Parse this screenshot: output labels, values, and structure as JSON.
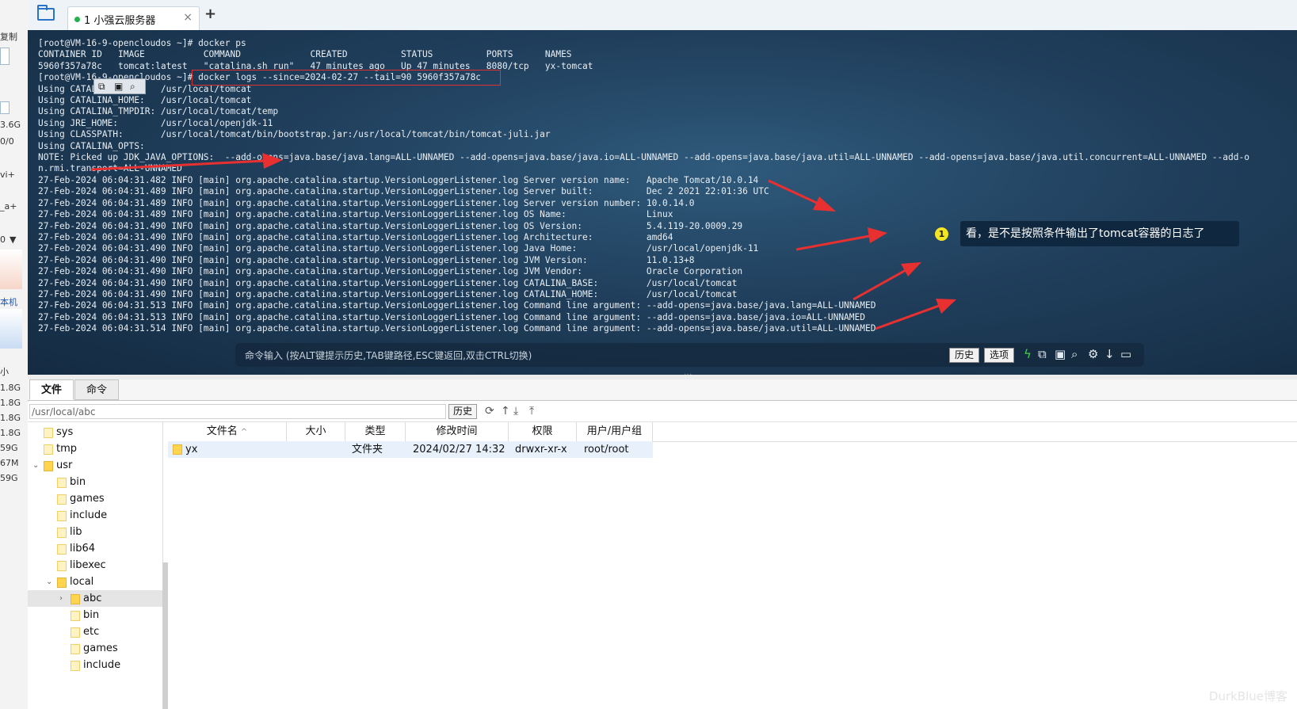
{
  "left_strip": {
    "labels": [
      "复制",
      "3.6G",
      "0/0",
      "vi+",
      "_a+",
      "0",
      "本机",
      "小",
      "1.8G",
      "1.8G",
      "1.8G",
      "1.8G",
      "59G",
      "67M",
      "59G"
    ]
  },
  "tabbar": {
    "session_tab_title": "1 小强云服务器",
    "close_glyph": "×",
    "add_glyph": "+"
  },
  "terminal": {
    "lines": [
      "[root@VM-16-9-opencloudos ~]# docker ps",
      "CONTAINER ID   IMAGE           COMMAND             CREATED          STATUS          PORTS      NAMES",
      "5960f357a78c   tomcat:latest   \"catalina.sh run\"   47 minutes ago   Up 47 minutes   8080/tcp   yx-tomcat",
      "[root@VM-16-9-opencloudos ~]# docker logs --since=2024-02-27 --tail=90 5960f357a78c",
      "Using CATALINA_BASE:   /usr/local/tomcat",
      "Using CATALINA_HOME:   /usr/local/tomcat",
      "Using CATALINA_TMPDIR: /usr/local/tomcat/temp",
      "Using JRE_HOME:        /usr/local/openjdk-11",
      "Using CLASSPATH:       /usr/local/tomcat/bin/bootstrap.jar:/usr/local/tomcat/bin/tomcat-juli.jar",
      "Using CATALINA_OPTS:",
      "NOTE: Picked up JDK_JAVA_OPTIONS:  --add-opens=java.base/java.lang=ALL-UNNAMED --add-opens=java.base/java.io=ALL-UNNAMED --add-opens=java.base/java.util=ALL-UNNAMED --add-opens=java.base/java.util.concurrent=ALL-UNNAMED --add-o",
      "n.rmi.transport=ALL-UNNAMED",
      "27-Feb-2024 06:04:31.482 INFO [main] org.apache.catalina.startup.VersionLoggerListener.log Server version name:   Apache Tomcat/10.0.14",
      "27-Feb-2024 06:04:31.489 INFO [main] org.apache.catalina.startup.VersionLoggerListener.log Server built:          Dec 2 2021 22:01:36 UTC",
      "27-Feb-2024 06:04:31.489 INFO [main] org.apache.catalina.startup.VersionLoggerListener.log Server version number: 10.0.14.0",
      "27-Feb-2024 06:04:31.489 INFO [main] org.apache.catalina.startup.VersionLoggerListener.log OS Name:               Linux",
      "27-Feb-2024 06:04:31.490 INFO [main] org.apache.catalina.startup.VersionLoggerListener.log OS Version:            5.4.119-20.0009.29",
      "27-Feb-2024 06:04:31.490 INFO [main] org.apache.catalina.startup.VersionLoggerListener.log Architecture:          amd64",
      "27-Feb-2024 06:04:31.490 INFO [main] org.apache.catalina.startup.VersionLoggerListener.log Java Home:             /usr/local/openjdk-11",
      "27-Feb-2024 06:04:31.490 INFO [main] org.apache.catalina.startup.VersionLoggerListener.log JVM Version:           11.0.13+8",
      "27-Feb-2024 06:04:31.490 INFO [main] org.apache.catalina.startup.VersionLoggerListener.log JVM Vendor:            Oracle Corporation",
      "27-Feb-2024 06:04:31.490 INFO [main] org.apache.catalina.startup.VersionLoggerListener.log CATALINA_BASE:         /usr/local/tomcat",
      "27-Feb-2024 06:04:31.490 INFO [main] org.apache.catalina.startup.VersionLoggerListener.log CATALINA_HOME:         /usr/local/tomcat",
      "27-Feb-2024 06:04:31.513 INFO [main] org.apache.catalina.startup.VersionLoggerListener.log Command line argument: --add-opens=java.base/java.lang=ALL-UNNAMED",
      "27-Feb-2024 06:04:31.513 INFO [main] org.apache.catalina.startup.VersionLoggerListener.log Command line argument: --add-opens=java.base/java.io=ALL-UNNAMED",
      "27-Feb-2024 06:04:31.514 INFO [main] org.apache.catalina.startup.VersionLoggerListener.log Command line argument: --add-opens=java.base/java.util=ALL-UNNAMED"
    ],
    "annotation": {
      "number": "1",
      "text": "看，是不是按照条件输出了tomcat容器的日志了"
    },
    "command_bar": {
      "placeholder": "命令输入 (按ALT键提示历史,TAB键路径,ESC键返回,双击CTRL切换)",
      "history_label": "历史",
      "options_label": "选项"
    }
  },
  "colors": {
    "accent_red": "#e83030",
    "annotation_yellow": "#f4e523",
    "status_green": "#23b14d"
  },
  "bottom_tabs": [
    "文件",
    "命令"
  ],
  "path_bar": {
    "path": "/usr/local/abc",
    "history_label": "历史"
  },
  "tree": [
    {
      "name": "sys",
      "level": 0,
      "expanded": false,
      "selected": false
    },
    {
      "name": "tmp",
      "level": 0,
      "expanded": false,
      "selected": false
    },
    {
      "name": "usr",
      "level": 0,
      "expanded": true,
      "selected": false
    },
    {
      "name": "bin",
      "level": 1,
      "expanded": false,
      "selected": false
    },
    {
      "name": "games",
      "level": 1,
      "expanded": false,
      "selected": false
    },
    {
      "name": "include",
      "level": 1,
      "expanded": false,
      "selected": false
    },
    {
      "name": "lib",
      "level": 1,
      "expanded": false,
      "selected": false
    },
    {
      "name": "lib64",
      "level": 1,
      "expanded": false,
      "selected": false
    },
    {
      "name": "libexec",
      "level": 1,
      "expanded": false,
      "selected": false
    },
    {
      "name": "local",
      "level": 1,
      "expanded": true,
      "selected": false
    },
    {
      "name": "abc",
      "level": 2,
      "expanded": false,
      "selected": true
    },
    {
      "name": "bin",
      "level": 2,
      "expanded": false,
      "selected": false
    },
    {
      "name": "etc",
      "level": 2,
      "expanded": false,
      "selected": false
    },
    {
      "name": "games",
      "level": 2,
      "expanded": false,
      "selected": false
    },
    {
      "name": "include",
      "level": 2,
      "expanded": false,
      "selected": false
    }
  ],
  "table": {
    "columns": [
      "文件名",
      "大小",
      "类型",
      "修改时间",
      "权限",
      "用户/用户组"
    ],
    "sort_indicator": "^",
    "rows": [
      {
        "name": "yx",
        "size": "",
        "type": "文件夹",
        "modified": "2024/02/27 14:32",
        "permissions": "drwxr-xr-x",
        "owner": "root/root"
      }
    ]
  },
  "watermark": "DurkBlue博客"
}
